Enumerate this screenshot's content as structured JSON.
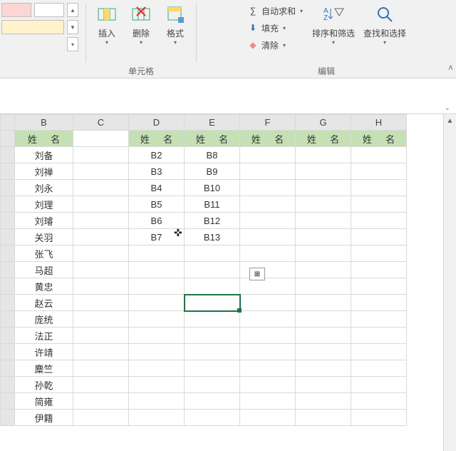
{
  "ribbon": {
    "cells_group": {
      "label": "单元格",
      "insert": "插入",
      "delete": "删除",
      "format": "格式"
    },
    "edit_group": {
      "label": "编辑",
      "autosum": "自动求和",
      "fill": "填充",
      "clear": "清除",
      "sortfilter": "排序和筛选",
      "findselect": "查找和选择"
    }
  },
  "columns": [
    "B",
    "C",
    "D",
    "E",
    "F",
    "G",
    "H"
  ],
  "header_label": "姓 名",
  "chart_data": {
    "type": "table",
    "title": "",
    "columns": [
      "B",
      "C",
      "D",
      "E",
      "F",
      "G",
      "H"
    ],
    "column_headers": [
      "姓 名",
      "",
      "姓 名",
      "姓 名",
      "姓 名",
      "姓 名",
      "姓 名"
    ],
    "rows": [
      {
        "B": "刘备",
        "D": "B2",
        "E": "B8"
      },
      {
        "B": "刘禅",
        "D": "B3",
        "E": "B9"
      },
      {
        "B": "刘永",
        "D": "B4",
        "E": "B10"
      },
      {
        "B": "刘理",
        "D": "B5",
        "E": "B11"
      },
      {
        "B": "刘璿",
        "D": "B6",
        "E": "B12"
      },
      {
        "B": "关羽",
        "D": "B7",
        "E": "B13"
      },
      {
        "B": "张飞"
      },
      {
        "B": "马超"
      },
      {
        "B": "黄忠"
      },
      {
        "B": "赵云"
      },
      {
        "B": "庞统"
      },
      {
        "B": "法正"
      },
      {
        "B": "许靖"
      },
      {
        "B": "麋竺"
      },
      {
        "B": "孙乾"
      },
      {
        "B": "简雍"
      },
      {
        "B": "伊籍"
      }
    ]
  },
  "names": [
    "刘备",
    "刘禅",
    "刘永",
    "刘理",
    "刘璿",
    "关羽",
    "张飞",
    "马超",
    "黄忠",
    "赵云",
    "庞统",
    "法正",
    "许靖",
    "麋竺",
    "孙乾",
    "简雍",
    "伊籍"
  ],
  "colD": [
    "B2",
    "B3",
    "B4",
    "B5",
    "B6",
    "B7",
    "",
    "",
    "",
    "",
    "",
    "",
    "",
    "",
    "",
    "",
    ""
  ],
  "colE": [
    "B8",
    "B9",
    "B10",
    "B11",
    "B12",
    "B13",
    "",
    "",
    "",
    "",
    "",
    "",
    "",
    "",
    "",
    "",
    ""
  ],
  "selected_cell": "E11",
  "autofill_glyph": "⊞"
}
